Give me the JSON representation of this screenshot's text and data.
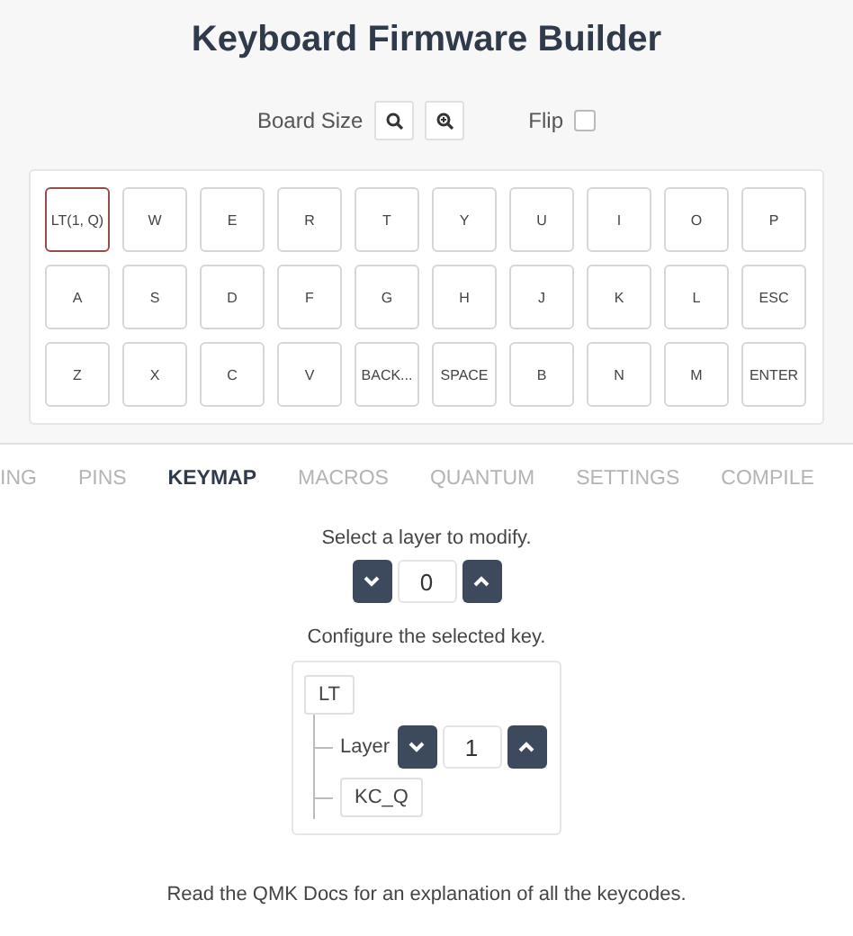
{
  "title": "Keyboard Firmware Builder",
  "board_size": {
    "label": "Board Size",
    "buttons": [
      {
        "kind": "zoom-out"
      },
      {
        "kind": "zoom-in"
      }
    ]
  },
  "flip": {
    "label": "Flip",
    "checked": false
  },
  "keys": [
    [
      {
        "label": "LT(1, Q)",
        "selected": true
      },
      {
        "label": "W",
        "selected": false
      },
      {
        "label": "E",
        "selected": false
      },
      {
        "label": "R",
        "selected": false
      },
      {
        "label": "T",
        "selected": false
      },
      {
        "label": "Y",
        "selected": false
      },
      {
        "label": "U",
        "selected": false
      },
      {
        "label": "I",
        "selected": false
      },
      {
        "label": "O",
        "selected": false
      },
      {
        "label": "P",
        "selected": false
      }
    ],
    [
      {
        "label": "A",
        "selected": false
      },
      {
        "label": "S",
        "selected": false
      },
      {
        "label": "D",
        "selected": false
      },
      {
        "label": "F",
        "selected": false
      },
      {
        "label": "G",
        "selected": false
      },
      {
        "label": "H",
        "selected": false
      },
      {
        "label": "J",
        "selected": false
      },
      {
        "label": "K",
        "selected": false
      },
      {
        "label": "L",
        "selected": false
      },
      {
        "label": "ESC",
        "selected": false
      }
    ],
    [
      {
        "label": "Z",
        "selected": false
      },
      {
        "label": "X",
        "selected": false
      },
      {
        "label": "C",
        "selected": false
      },
      {
        "label": "V",
        "selected": false
      },
      {
        "label": "BACK...",
        "selected": false
      },
      {
        "label": "SPACE",
        "selected": false
      },
      {
        "label": "B",
        "selected": false
      },
      {
        "label": "N",
        "selected": false
      },
      {
        "label": "M",
        "selected": false
      },
      {
        "label": "ENTER",
        "selected": false
      }
    ]
  ],
  "tabs": [
    {
      "label": "ING",
      "selected": false
    },
    {
      "label": "PINS",
      "selected": false
    },
    {
      "label": "KEYMAP",
      "selected": true
    },
    {
      "label": "MACROS",
      "selected": false
    },
    {
      "label": "QUANTUM",
      "selected": false
    },
    {
      "label": "SETTINGS",
      "selected": false
    },
    {
      "label": "COMPILE",
      "selected": false
    }
  ],
  "layer_prompt": "Select a layer to modify.",
  "layer": {
    "value": "0"
  },
  "key_prompt": "Configure the selected key.",
  "key_tree": {
    "label": "LT",
    "children": [
      {
        "kind": "number",
        "label": "Layer",
        "value": "1"
      },
      {
        "kind": "keycode",
        "label": "KC_Q"
      }
    ]
  },
  "footer": "Read the QMK Docs for an explanation of all the keycodes."
}
